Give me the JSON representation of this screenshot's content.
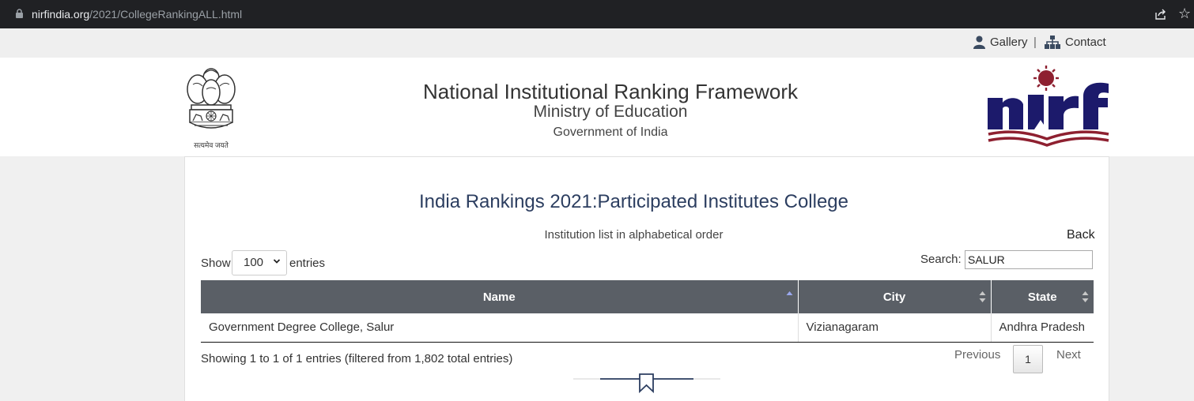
{
  "browser": {
    "url_host": "nirfindia.org",
    "url_path": "/2021/CollegeRankingALL.html"
  },
  "topbar": {
    "gallery": "Gallery",
    "separator": "|",
    "contact": "Contact"
  },
  "header": {
    "emblem_motto": "सत्यमेव जयते",
    "title": "National Institutional Ranking Framework",
    "ministry": "Ministry of Education",
    "government": "Government of India"
  },
  "main": {
    "heading": "India Rankings 2021:Participated Institutes College",
    "subtitle": "Institution list in alphabetical order",
    "back": "Back",
    "show_label": "Show",
    "show_value": "100",
    "entries_label": "entries",
    "search_label": "Search:",
    "search_value": "SALUR"
  },
  "table": {
    "columns": [
      "Name",
      "City",
      "State"
    ],
    "rows": [
      [
        "Government Degree College, Salur",
        "Vizianagaram",
        "Andhra Pradesh"
      ]
    ]
  },
  "footer": {
    "info": "Showing 1 to 1 of 1 entries (filtered from 1,802 total entries)",
    "previous": "Previous",
    "page": "1",
    "next": "Next"
  },
  "colors": {
    "table_header": "#5a5f66",
    "nirf_blue": "#1c1a6b",
    "nirf_red": "#8e2030",
    "heading": "#2c3e60"
  }
}
